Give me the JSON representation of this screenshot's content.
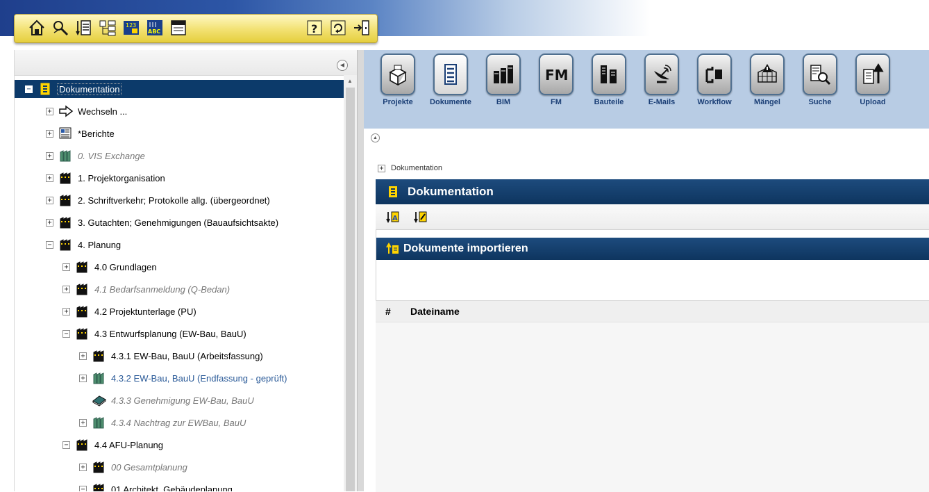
{
  "toolbar": {
    "icons": [
      "home-icon",
      "search-icon",
      "document-list-icon",
      "tree-structure-icon",
      "numbered-list-icon",
      "abc-sort-icon",
      "form-icon",
      "help-icon",
      "refresh-icon",
      "logout-icon"
    ]
  },
  "tree": {
    "items": [
      {
        "label": "Dokumentation",
        "expanded": true,
        "selected": true
      },
      {
        "label": "Wechseln ..."
      },
      {
        "label": "*Berichte"
      },
      {
        "label": "0. VIS Exchange",
        "style": "disabled"
      },
      {
        "label": "1. Projektorganisation"
      },
      {
        "label": "2. Schriftverkehr; Protokolle allg. (übergeordnet)"
      },
      {
        "label": "3. Gutachten; Genehmigungen (Bauaufsichtsakte)"
      },
      {
        "label": "4. Planung",
        "expanded": true
      },
      {
        "label": "4.0 Grundlagen"
      },
      {
        "label": "4.1 Bedarfsanmeldung (Q-Bedan)",
        "style": "disabled"
      },
      {
        "label": "4.2 Projektunterlage (PU)"
      },
      {
        "label": "4.3 Entwurfsplanung (EW-Bau, BauU)",
        "expanded": true
      },
      {
        "label": "4.3.1 EW-Bau, BauU (Arbeitsfassung)"
      },
      {
        "label": "4.3.2 EW-Bau, BauU (Endfassung - geprüft)",
        "style": "highlight"
      },
      {
        "label": "4.3.3 Genehmigung EW-Bau, BauU",
        "style": "disabled"
      },
      {
        "label": "4.3.4 Nachtrag zur EWBau, BauU",
        "style": "disabled"
      },
      {
        "label": "4.4 AFU-Planung",
        "expanded": true
      },
      {
        "label": "00 Gesamtplanung",
        "style": "disabled"
      },
      {
        "label": "01 Architekt_Gebäudeplanung",
        "expanded": true
      }
    ]
  },
  "modules": [
    {
      "label": "Projekte",
      "icon": "projects-box-icon"
    },
    {
      "label": "Dokumente",
      "icon": "documents-cabinet-icon",
      "active": true
    },
    {
      "label": "BIM",
      "icon": "bim-building-icon"
    },
    {
      "label": "FM",
      "icon": "fm-icon"
    },
    {
      "label": "Bauteile",
      "icon": "building-parts-icon"
    },
    {
      "label": "E-Mails",
      "icon": "email-satellite-icon"
    },
    {
      "label": "Workflow",
      "icon": "workflow-icon"
    },
    {
      "label": "Mängel",
      "icon": "defects-warning-icon"
    },
    {
      "label": "Suche",
      "icon": "search-documents-icon"
    },
    {
      "label": "Upload",
      "icon": "upload-icon"
    }
  ],
  "breadcrumb": {
    "label": "Dokumentation"
  },
  "panel": {
    "title": "Dokumentation"
  },
  "import": {
    "title": "Dokumente importieren"
  },
  "table": {
    "columns": [
      "#",
      "Dateiname"
    ]
  },
  "colors": {
    "header_blue": "#0e355f",
    "module_bar": "#b8cce4",
    "toolbar_yellow": "#f2e171"
  }
}
